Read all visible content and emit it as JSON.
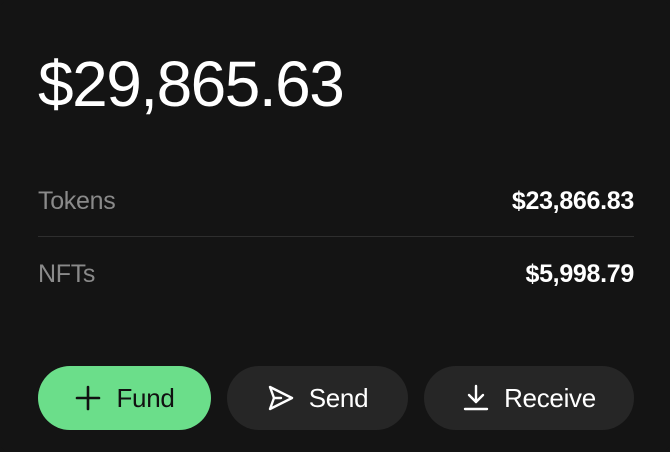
{
  "balance": {
    "total": "$29,865.63"
  },
  "breakdown": [
    {
      "label": "Tokens",
      "value": "$23,866.83"
    },
    {
      "label": "NFTs",
      "value": "$5,998.79"
    }
  ],
  "actions": {
    "fund": {
      "label": "Fund",
      "icon": "plus-icon",
      "color": "#6bde8a"
    },
    "send": {
      "label": "Send",
      "icon": "send-icon"
    },
    "receive": {
      "label": "Receive",
      "icon": "download-icon"
    }
  },
  "colors": {
    "background": "#141414",
    "button_dark": "#262626",
    "accent": "#6bde8a",
    "muted_text": "#8a8a8a"
  }
}
